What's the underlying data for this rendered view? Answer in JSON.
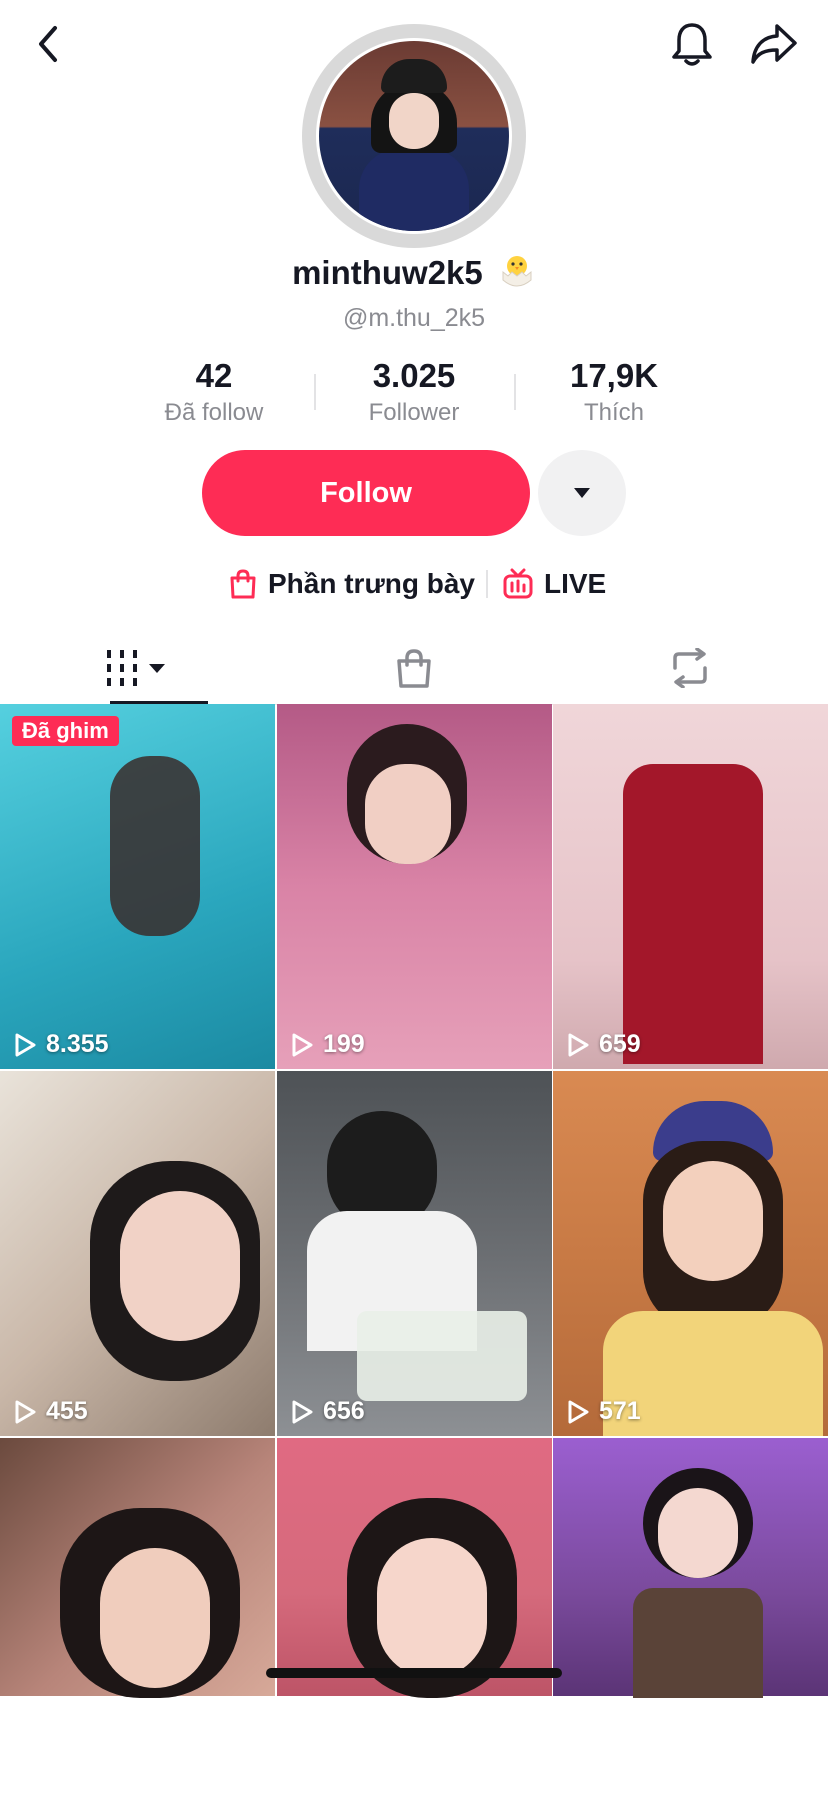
{
  "header": {
    "back_icon": "chevron-left-icon",
    "bell_icon": "bell-icon",
    "share_icon": "share-arrow-icon"
  },
  "profile": {
    "username": "minthuw2k5",
    "username_emoji": "hatching-chick-emoji",
    "handle": "@m.thu_2k5"
  },
  "stats": [
    {
      "value": "42",
      "label": "Đã follow"
    },
    {
      "value": "3.025",
      "label": "Follower"
    },
    {
      "value": "17,9K",
      "label": "Thích"
    }
  ],
  "actions": {
    "follow_label": "Follow",
    "more_icon": "caret-down-icon"
  },
  "links": {
    "showcase_label": "Phần trưng bày",
    "live_label": "LIVE"
  },
  "tabs": [
    {
      "icon": "videos-grid-icon",
      "active": true
    },
    {
      "icon": "shopping-bag-icon",
      "active": false
    },
    {
      "icon": "repost-icon",
      "active": false
    }
  ],
  "videos": [
    {
      "views": "8.355",
      "pinned_label": "Đã ghim",
      "bg": "#3bb6c9"
    },
    {
      "views": "199",
      "bg": "#c46a8a"
    },
    {
      "views": "659",
      "bg": "#e8c9cc"
    },
    {
      "views": "455",
      "bg": "#c9b7a8"
    },
    {
      "views": "656",
      "bg": "#6b6e72"
    },
    {
      "views": "571",
      "bg": "#c87a45"
    },
    {
      "views": "",
      "bg": "#b8857a"
    },
    {
      "views": "",
      "bg": "#d56a7c"
    },
    {
      "views": "",
      "bg": "#7a4a9c"
    }
  ],
  "colors": {
    "accent": "#fe2c55",
    "text": "#161823",
    "muted": "#8a8b91"
  }
}
